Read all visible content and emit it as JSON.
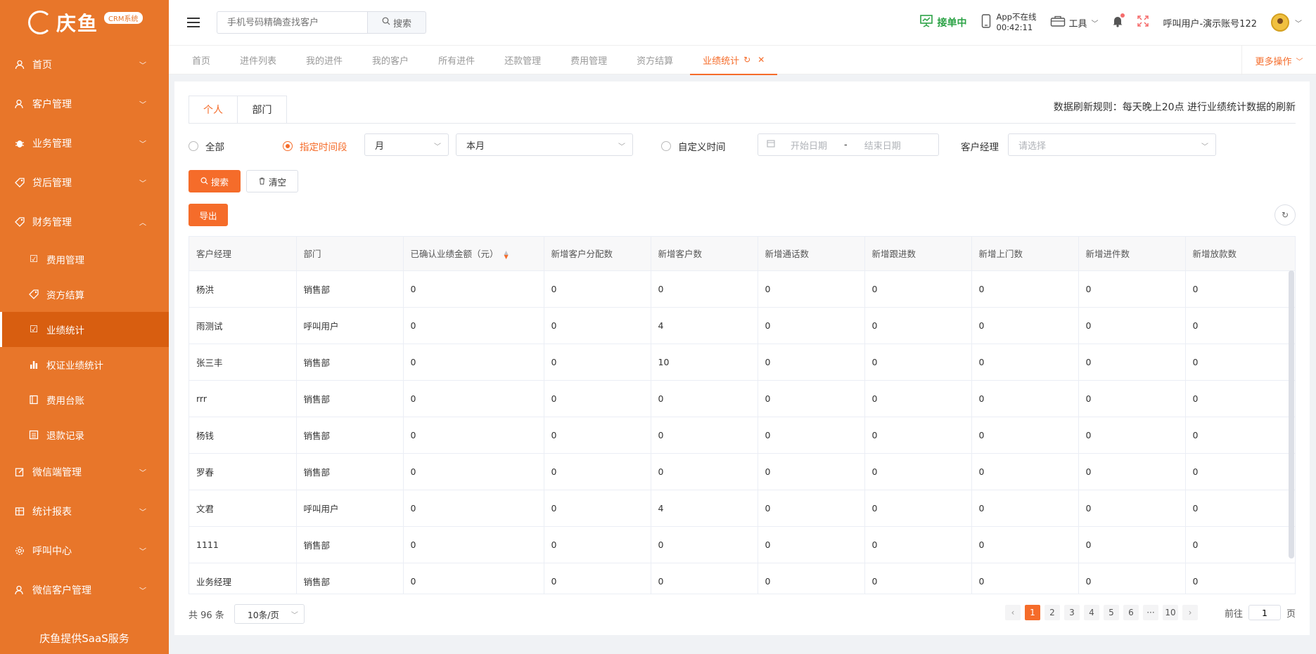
{
  "sidebar": {
    "logo_text": "庆鱼",
    "logo_badge": "CRM系统",
    "items": [
      {
        "label": "首页"
      },
      {
        "label": "客户管理"
      },
      {
        "label": "业务管理"
      },
      {
        "label": "贷后管理"
      },
      {
        "label": "财务管理"
      }
    ],
    "finance_sub": [
      {
        "label": "费用管理"
      },
      {
        "label": "资方结算"
      },
      {
        "label": "业绩统计"
      },
      {
        "label": "权证业绩统计"
      },
      {
        "label": "费用台账"
      },
      {
        "label": "退款记录"
      }
    ],
    "items_after": [
      {
        "label": "微信端管理"
      },
      {
        "label": "统计报表"
      },
      {
        "label": "呼叫中心"
      },
      {
        "label": "微信客户管理"
      }
    ],
    "footer": "庆鱼提供SaaS服务"
  },
  "header": {
    "search_placeholder": "手机号码精确查找客户",
    "search_button": "搜索",
    "status": "接单中",
    "app_status": "App不在线",
    "app_timer": "00:42:11",
    "tools": "工具",
    "user_name": "呼叫用户-演示账号122"
  },
  "tabs": {
    "items": [
      {
        "label": "首页"
      },
      {
        "label": "进件列表"
      },
      {
        "label": "我的进件"
      },
      {
        "label": "我的客户"
      },
      {
        "label": "所有进件"
      },
      {
        "label": "还款管理"
      },
      {
        "label": "费用管理"
      },
      {
        "label": "资方结算"
      }
    ],
    "active": "业绩统计",
    "more": "更多操作"
  },
  "content": {
    "sub_tabs": [
      "个人",
      "部门"
    ],
    "refresh_rule": "数据刷新规则：每天晚上20点 进行业绩统计数据的刷新",
    "filters": {
      "radio_all": "全部",
      "radio_period": "指定时间段",
      "period_unit": "月",
      "period_value": "本月",
      "radio_custom": "自定义时间",
      "start_placeholder": "开始日期",
      "range_sep": "-",
      "end_placeholder": "结束日期",
      "manager_label": "客户经理",
      "manager_placeholder": "请选择"
    },
    "buttons": {
      "search": "搜索",
      "clear": "清空",
      "export": "导出"
    }
  },
  "table": {
    "headers": [
      "客户经理",
      "部门",
      "已确认业绩金额（元）",
      "新增客户分配数",
      "新增客户数",
      "新增通话数",
      "新增跟进数",
      "新增上门数",
      "新增进件数",
      "新增放款数"
    ],
    "rows": [
      [
        "杨洪",
        "销售部",
        "0",
        "0",
        "0",
        "0",
        "0",
        "0",
        "0",
        "0"
      ],
      [
        "雨测试",
        "呼叫用户",
        "0",
        "0",
        "4",
        "0",
        "0",
        "0",
        "0",
        "0"
      ],
      [
        "张三丰",
        "销售部",
        "0",
        "0",
        "10",
        "0",
        "0",
        "0",
        "0",
        "0"
      ],
      [
        "rrr",
        "销售部",
        "0",
        "0",
        "0",
        "0",
        "0",
        "0",
        "0",
        "0"
      ],
      [
        "杨钱",
        "销售部",
        "0",
        "0",
        "0",
        "0",
        "0",
        "0",
        "0",
        "0"
      ],
      [
        "罗春",
        "销售部",
        "0",
        "0",
        "0",
        "0",
        "0",
        "0",
        "0",
        "0"
      ],
      [
        "文君",
        "呼叫用户",
        "0",
        "0",
        "4",
        "0",
        "0",
        "0",
        "0",
        "0"
      ],
      [
        "1111",
        "销售部",
        "0",
        "0",
        "0",
        "0",
        "0",
        "0",
        "0",
        "0"
      ],
      [
        "业务经理",
        "销售部",
        "0",
        "0",
        "0",
        "0",
        "0",
        "0",
        "0",
        "0"
      ]
    ]
  },
  "pagination": {
    "total": "共 96 条",
    "page_size": "10条/页",
    "pages": [
      "1",
      "2",
      "3",
      "4",
      "5",
      "6",
      "···",
      "10"
    ],
    "active_page": "1",
    "goto_label": "前往",
    "goto_value": "1",
    "goto_suffix": "页"
  },
  "colors": {
    "brand": "#e8762a",
    "accent": "#f56c2a",
    "online": "#2ba245"
  }
}
